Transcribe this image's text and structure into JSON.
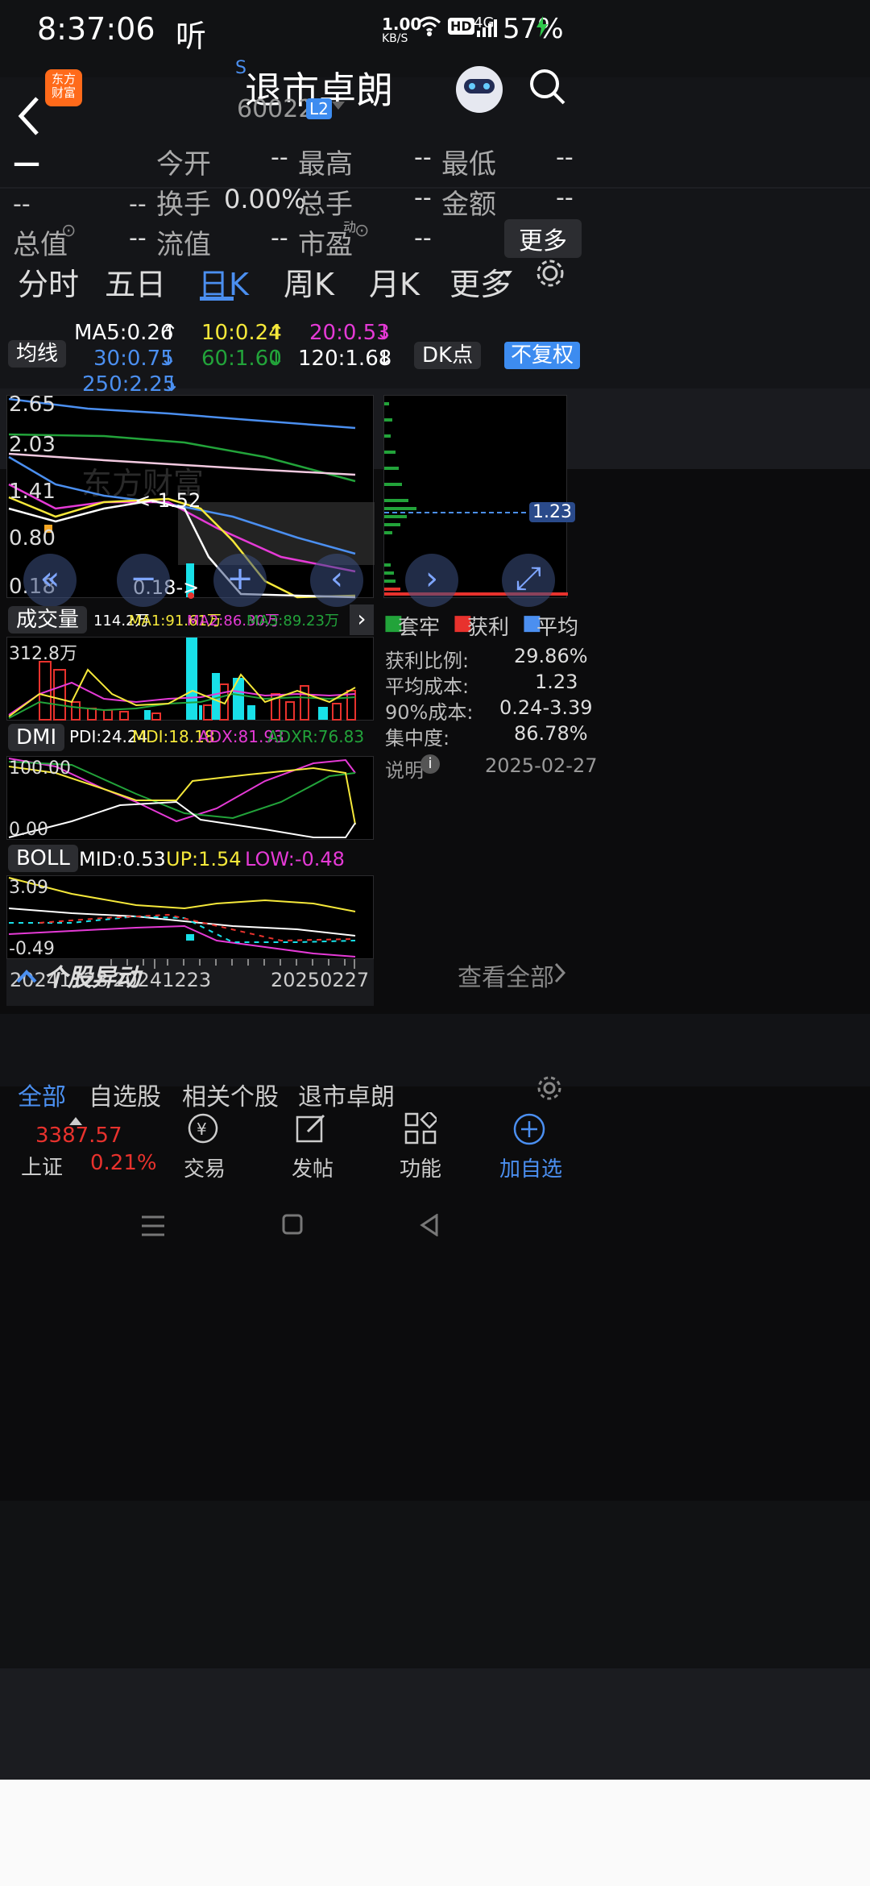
{
  "status": {
    "time": "8:37:06",
    "ting": "听",
    "net_speed_top": "1.00",
    "net_speed_bottom": "KB/S",
    "hd": "HD",
    "signal": "4G",
    "battery": "57%"
  },
  "header": {
    "logo_top": "东方",
    "logo_bottom": "财富",
    "badge": "S",
    "title": "退市卓朗",
    "code": "600225",
    "l2": "L2"
  },
  "quote": {
    "price": "—",
    "change": "--",
    "change_pct": "--",
    "fields": [
      {
        "label": "今开",
        "value": "--"
      },
      {
        "label": "最高",
        "value": "--"
      },
      {
        "label": "最低",
        "value": "--"
      },
      {
        "label": "换手",
        "value": "0.00%"
      },
      {
        "label": "总手",
        "value": "--"
      },
      {
        "label": "金额",
        "value": "--"
      },
      {
        "label": "总值",
        "value": "--"
      },
      {
        "label": "流值",
        "value": "--"
      },
      {
        "label": "市盈",
        "value": "--"
      }
    ],
    "dong": "动",
    "more": "更多"
  },
  "tabs": [
    "分时",
    "五日",
    "日K",
    "周K",
    "月K",
    "更多"
  ],
  "ma_legend": {
    "dropdown": "均线",
    "ma5": "MA5:0.26",
    "ma10": "10:0.24",
    "ma20": "20:0.53",
    "ma30": "30:0.75",
    "ma60": "60:1.60",
    "ma120": "120:1.68",
    "ma250": "250:2.25",
    "dk": "DK点",
    "fq": "不复权"
  },
  "main_chart": {
    "y_labels": [
      "2.65",
      "2.03",
      "1.41",
      "0.80",
      "0.18"
    ],
    "high_mark": "<-1.52",
    "low_mark": "0.18->",
    "watermark": "东方财富"
  },
  "volume": {
    "dropdown": "成交量",
    "vol": "114.2万",
    "ma1": "MA1:91.61万",
    "ma2": "MA2:86.30万",
    "ma3": "MA3:89.23万",
    "y_top": "312.8万"
  },
  "dmi": {
    "dropdown": "DMI",
    "pdi": "PDI:24.24",
    "mdi": "MDI:18.18",
    "adx": "ADX:81.93",
    "adxr": "ADXR:76.83",
    "y_top": "100.00",
    "y_bottom": "0.00"
  },
  "boll": {
    "dropdown": "BOLL",
    "mid": "MID:0.53",
    "up": "UP:1.54",
    "low": "LOW:-0.48",
    "y_top": "3.09",
    "y_bottom": "-0.49"
  },
  "dates": [
    "20241128",
    "20241223",
    "20250227"
  ],
  "chip": {
    "price_tag": "1.23",
    "legend": [
      "套牢",
      "获利",
      "平均"
    ],
    "rows": [
      {
        "label": "获利比例:",
        "value": "29.86%"
      },
      {
        "label": "平均成本:",
        "value": "1.23"
      },
      {
        "label": "90%成本:",
        "value": "0.24-3.39"
      },
      {
        "label": "集中度:",
        "value": "86.78%"
      }
    ],
    "note_label": "说明",
    "note_date": "2025-02-27"
  },
  "abnormal": {
    "title": "个股异动",
    "view_all": "查看全部"
  },
  "filters": [
    "全部",
    "自选股",
    "相关个股",
    "退市卓朗"
  ],
  "bottom": {
    "index_value": "3387.57",
    "index_name": "上证",
    "index_pct": "0.21%",
    "items": [
      "交易",
      "发帖",
      "功能",
      "加自选"
    ]
  },
  "colors": {
    "red": "#e8322d",
    "cyan": "#18e0e8",
    "yellow": "#f5e83a",
    "magenta": "#e53ad6",
    "green": "#22a33a",
    "blue": "#4b8ff0",
    "accent": "#3d8cf0"
  }
}
